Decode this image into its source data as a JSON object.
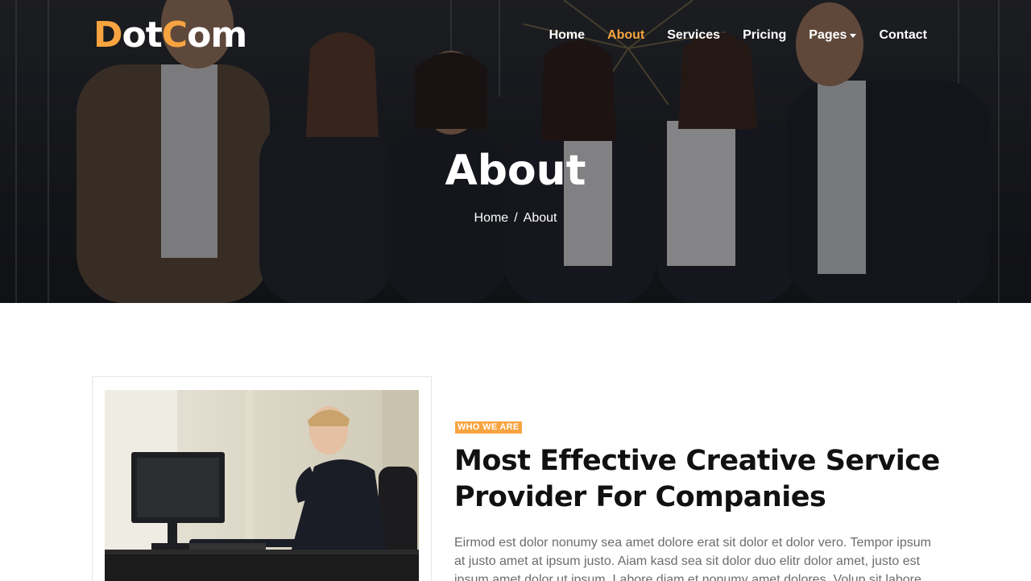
{
  "brand": {
    "part1": "D",
    "part2": "ot",
    "part3": "C",
    "part4": "om",
    "accent_color": "#f7a440"
  },
  "nav": {
    "items": [
      {
        "label": "Home",
        "active": false
      },
      {
        "label": "About",
        "active": true
      },
      {
        "label": "Services",
        "active": false
      },
      {
        "label": "Pricing",
        "active": false
      },
      {
        "label": "Pages",
        "active": false,
        "dropdown": true
      },
      {
        "label": "Contact",
        "active": false
      }
    ]
  },
  "hero": {
    "title": "About",
    "breadcrumb": {
      "home": "Home",
      "separator": "/",
      "current": "About"
    },
    "image": "team-photo"
  },
  "about": {
    "tag": "WHO WE ARE",
    "heading_line1": "Most Effective Creative Service",
    "heading_line2": "Provider For Companies",
    "paragraph": "Eirmod est dolor nonumy sea amet dolore erat sit dolor et dolor vero. Tempor ipsum at justo amet at ipsum justo. Aiam kasd sea sit dolor duo elitr dolor amet, justo est ipsum amet dolor ut ipsum. Labore diam et nonumy amet dolores. Volup sit labore",
    "image": "man-at-computer-photo"
  }
}
